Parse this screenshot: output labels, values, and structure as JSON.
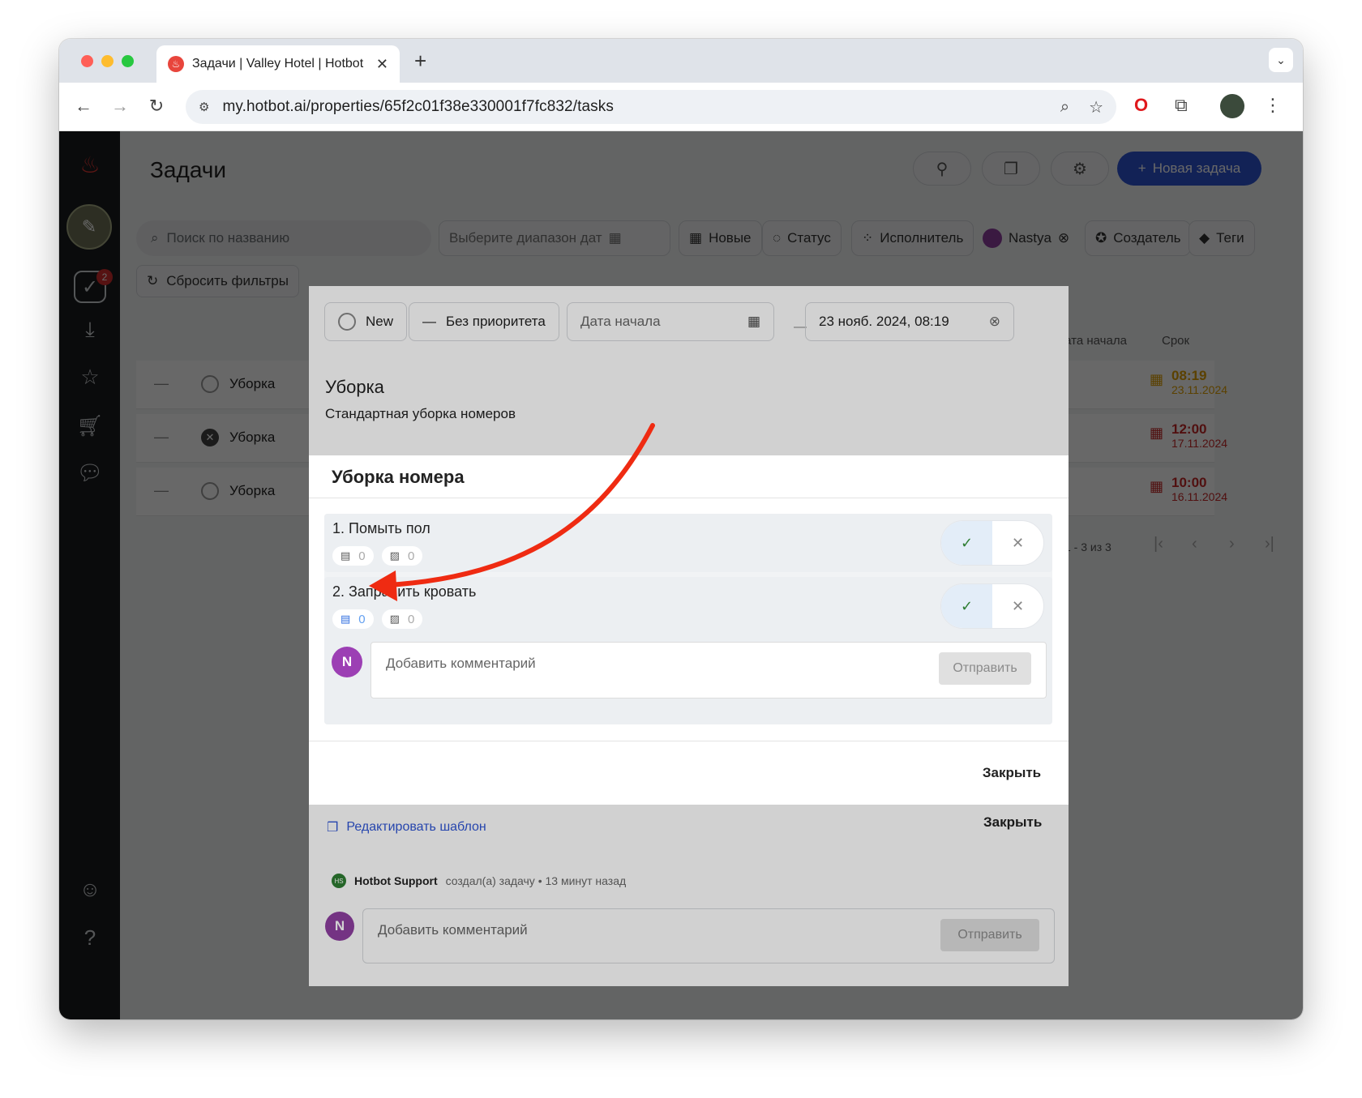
{
  "browser": {
    "tab_title": "Задачи | Valley Hotel | Hotbot",
    "url": "my.hotbot.ai/properties/65f2c01f38e330001f7fc832/tasks"
  },
  "header": {
    "title": "Задачи",
    "new_task_label": "Новая задача"
  },
  "sidebar": {
    "badge_count": "2"
  },
  "filters": {
    "search_placeholder": "Поиск по названию",
    "date_range_placeholder": "Выберите диапазон дат",
    "status_new": "Новые",
    "status": "Статус",
    "assignee": "Исполнитель",
    "user_chip": "Nastya",
    "creator": "Создатель",
    "tags": "Теги",
    "reset": "Сбросить фильтры"
  },
  "table": {
    "columns": {
      "start_date": "Дата начала",
      "due": "Срок"
    },
    "rows": [
      {
        "name": "Уборка",
        "status": "open",
        "due_time": "08:19",
        "due_date": "23.11.2024",
        "color": "#e0a000"
      },
      {
        "name": "Уборка",
        "status": "cancelled",
        "due_time": "12:00",
        "due_date": "17.11.2024",
        "color": "#c62828"
      },
      {
        "name": "Уборка",
        "status": "open",
        "due_time": "10:00",
        "due_date": "16.11.2024",
        "color": "#c62828"
      }
    ],
    "pagination": "1 - 3 из 3"
  },
  "task_modal": {
    "status": "New",
    "priority": "Без приоритета",
    "start_date_placeholder": "Дата начала",
    "due_date": "23 нояб. 2024, 08:19",
    "title": "Уборка",
    "description": "Стандартная уборка номеров",
    "edit_template": "Редактировать шаблон",
    "close": "Закрыть",
    "author": "Hotbot Support",
    "author_badge": "HS",
    "activity": "создал(а) задачу • 13 минут назад",
    "avatar_initial": "N",
    "comment_placeholder": "Добавить комментарий",
    "send": "Отправить"
  },
  "checklist_modal": {
    "title": "Уборка номера",
    "items": [
      {
        "label": "1. Помыть пол",
        "comments": "0",
        "photos": "0"
      },
      {
        "label": "2. Заправить кровать",
        "comments": "0",
        "photos": "0"
      }
    ],
    "avatar_initial": "N",
    "comment_placeholder": "Добавить комментарий",
    "send": "Отправить",
    "close": "Закрыть"
  },
  "colors": {
    "accent": "#2f55d4",
    "annotation_arrow": "#ef2b12"
  }
}
